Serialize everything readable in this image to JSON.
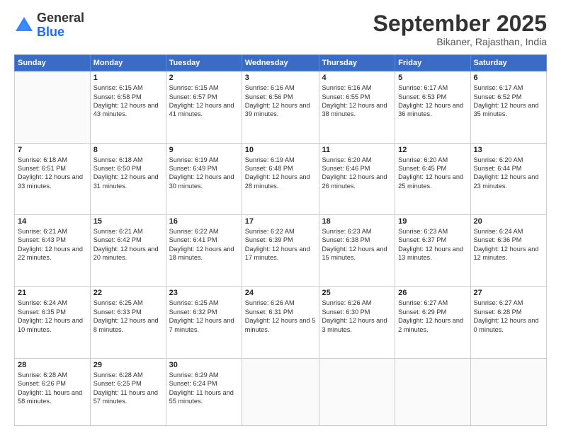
{
  "header": {
    "logo_general": "General",
    "logo_blue": "Blue",
    "month_title": "September 2025",
    "subtitle": "Bikaner, Rajasthan, India"
  },
  "weekdays": [
    "Sunday",
    "Monday",
    "Tuesday",
    "Wednesday",
    "Thursday",
    "Friday",
    "Saturday"
  ],
  "weeks": [
    [
      {
        "day": "",
        "sunrise": "",
        "sunset": "",
        "daylight": ""
      },
      {
        "day": "1",
        "sunrise": "Sunrise: 6:15 AM",
        "sunset": "Sunset: 6:58 PM",
        "daylight": "Daylight: 12 hours and 43 minutes."
      },
      {
        "day": "2",
        "sunrise": "Sunrise: 6:15 AM",
        "sunset": "Sunset: 6:57 PM",
        "daylight": "Daylight: 12 hours and 41 minutes."
      },
      {
        "day": "3",
        "sunrise": "Sunrise: 6:16 AM",
        "sunset": "Sunset: 6:56 PM",
        "daylight": "Daylight: 12 hours and 39 minutes."
      },
      {
        "day": "4",
        "sunrise": "Sunrise: 6:16 AM",
        "sunset": "Sunset: 6:55 PM",
        "daylight": "Daylight: 12 hours and 38 minutes."
      },
      {
        "day": "5",
        "sunrise": "Sunrise: 6:17 AM",
        "sunset": "Sunset: 6:53 PM",
        "daylight": "Daylight: 12 hours and 36 minutes."
      },
      {
        "day": "6",
        "sunrise": "Sunrise: 6:17 AM",
        "sunset": "Sunset: 6:52 PM",
        "daylight": "Daylight: 12 hours and 35 minutes."
      }
    ],
    [
      {
        "day": "7",
        "sunrise": "Sunrise: 6:18 AM",
        "sunset": "Sunset: 6:51 PM",
        "daylight": "Daylight: 12 hours and 33 minutes."
      },
      {
        "day": "8",
        "sunrise": "Sunrise: 6:18 AM",
        "sunset": "Sunset: 6:50 PM",
        "daylight": "Daylight: 12 hours and 31 minutes."
      },
      {
        "day": "9",
        "sunrise": "Sunrise: 6:19 AM",
        "sunset": "Sunset: 6:49 PM",
        "daylight": "Daylight: 12 hours and 30 minutes."
      },
      {
        "day": "10",
        "sunrise": "Sunrise: 6:19 AM",
        "sunset": "Sunset: 6:48 PM",
        "daylight": "Daylight: 12 hours and 28 minutes."
      },
      {
        "day": "11",
        "sunrise": "Sunrise: 6:20 AM",
        "sunset": "Sunset: 6:46 PM",
        "daylight": "Daylight: 12 hours and 26 minutes."
      },
      {
        "day": "12",
        "sunrise": "Sunrise: 6:20 AM",
        "sunset": "Sunset: 6:45 PM",
        "daylight": "Daylight: 12 hours and 25 minutes."
      },
      {
        "day": "13",
        "sunrise": "Sunrise: 6:20 AM",
        "sunset": "Sunset: 6:44 PM",
        "daylight": "Daylight: 12 hours and 23 minutes."
      }
    ],
    [
      {
        "day": "14",
        "sunrise": "Sunrise: 6:21 AM",
        "sunset": "Sunset: 6:43 PM",
        "daylight": "Daylight: 12 hours and 22 minutes."
      },
      {
        "day": "15",
        "sunrise": "Sunrise: 6:21 AM",
        "sunset": "Sunset: 6:42 PM",
        "daylight": "Daylight: 12 hours and 20 minutes."
      },
      {
        "day": "16",
        "sunrise": "Sunrise: 6:22 AM",
        "sunset": "Sunset: 6:41 PM",
        "daylight": "Daylight: 12 hours and 18 minutes."
      },
      {
        "day": "17",
        "sunrise": "Sunrise: 6:22 AM",
        "sunset": "Sunset: 6:39 PM",
        "daylight": "Daylight: 12 hours and 17 minutes."
      },
      {
        "day": "18",
        "sunrise": "Sunrise: 6:23 AM",
        "sunset": "Sunset: 6:38 PM",
        "daylight": "Daylight: 12 hours and 15 minutes."
      },
      {
        "day": "19",
        "sunrise": "Sunrise: 6:23 AM",
        "sunset": "Sunset: 6:37 PM",
        "daylight": "Daylight: 12 hours and 13 minutes."
      },
      {
        "day": "20",
        "sunrise": "Sunrise: 6:24 AM",
        "sunset": "Sunset: 6:36 PM",
        "daylight": "Daylight: 12 hours and 12 minutes."
      }
    ],
    [
      {
        "day": "21",
        "sunrise": "Sunrise: 6:24 AM",
        "sunset": "Sunset: 6:35 PM",
        "daylight": "Daylight: 12 hours and 10 minutes."
      },
      {
        "day": "22",
        "sunrise": "Sunrise: 6:25 AM",
        "sunset": "Sunset: 6:33 PM",
        "daylight": "Daylight: 12 hours and 8 minutes."
      },
      {
        "day": "23",
        "sunrise": "Sunrise: 6:25 AM",
        "sunset": "Sunset: 6:32 PM",
        "daylight": "Daylight: 12 hours and 7 minutes."
      },
      {
        "day": "24",
        "sunrise": "Sunrise: 6:26 AM",
        "sunset": "Sunset: 6:31 PM",
        "daylight": "Daylight: 12 hours and 5 minutes."
      },
      {
        "day": "25",
        "sunrise": "Sunrise: 6:26 AM",
        "sunset": "Sunset: 6:30 PM",
        "daylight": "Daylight: 12 hours and 3 minutes."
      },
      {
        "day": "26",
        "sunrise": "Sunrise: 6:27 AM",
        "sunset": "Sunset: 6:29 PM",
        "daylight": "Daylight: 12 hours and 2 minutes."
      },
      {
        "day": "27",
        "sunrise": "Sunrise: 6:27 AM",
        "sunset": "Sunset: 6:28 PM",
        "daylight": "Daylight: 12 hours and 0 minutes."
      }
    ],
    [
      {
        "day": "28",
        "sunrise": "Sunrise: 6:28 AM",
        "sunset": "Sunset: 6:26 PM",
        "daylight": "Daylight: 11 hours and 58 minutes."
      },
      {
        "day": "29",
        "sunrise": "Sunrise: 6:28 AM",
        "sunset": "Sunset: 6:25 PM",
        "daylight": "Daylight: 11 hours and 57 minutes."
      },
      {
        "day": "30",
        "sunrise": "Sunrise: 6:29 AM",
        "sunset": "Sunset: 6:24 PM",
        "daylight": "Daylight: 11 hours and 55 minutes."
      },
      {
        "day": "",
        "sunrise": "",
        "sunset": "",
        "daylight": ""
      },
      {
        "day": "",
        "sunrise": "",
        "sunset": "",
        "daylight": ""
      },
      {
        "day": "",
        "sunrise": "",
        "sunset": "",
        "daylight": ""
      },
      {
        "day": "",
        "sunrise": "",
        "sunset": "",
        "daylight": ""
      }
    ]
  ]
}
